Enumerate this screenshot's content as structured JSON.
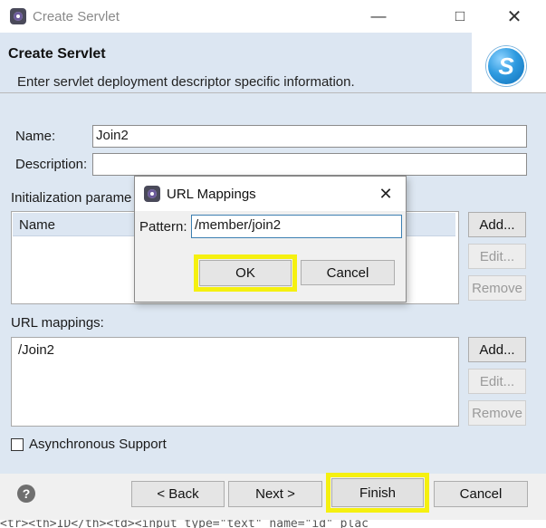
{
  "window": {
    "title": "Create Servlet"
  },
  "banner": {
    "title": "Create Servlet",
    "message": "Enter servlet deployment descriptor specific information.",
    "logo_letter": "S"
  },
  "form": {
    "name_label": "Name:",
    "name_value": "Join2",
    "description_label": "Description:",
    "description_value": "",
    "init_params_label": "Initialization parame",
    "init_params_header": "Name",
    "url_mappings_label": "URL mappings:",
    "url_mappings_items": [
      "/Join2"
    ],
    "async_label": "Asynchronous Support"
  },
  "side_buttons": {
    "add": "Add...",
    "edit": "Edit...",
    "remove": "Remove"
  },
  "footer": {
    "help": "?",
    "back": "< Back",
    "next": "Next >",
    "finish": "Finish",
    "cancel": "Cancel"
  },
  "dialog": {
    "title": "URL Mappings",
    "pattern_label": "Pattern:",
    "pattern_value": "/member/join2",
    "ok": "OK",
    "cancel": "Cancel"
  },
  "background_code": "<tr><th>ID</th><td><input type=\"text\" name=\"id\" plac",
  "highlight_color": "#f5f010",
  "banner_color": "#dce6f2"
}
